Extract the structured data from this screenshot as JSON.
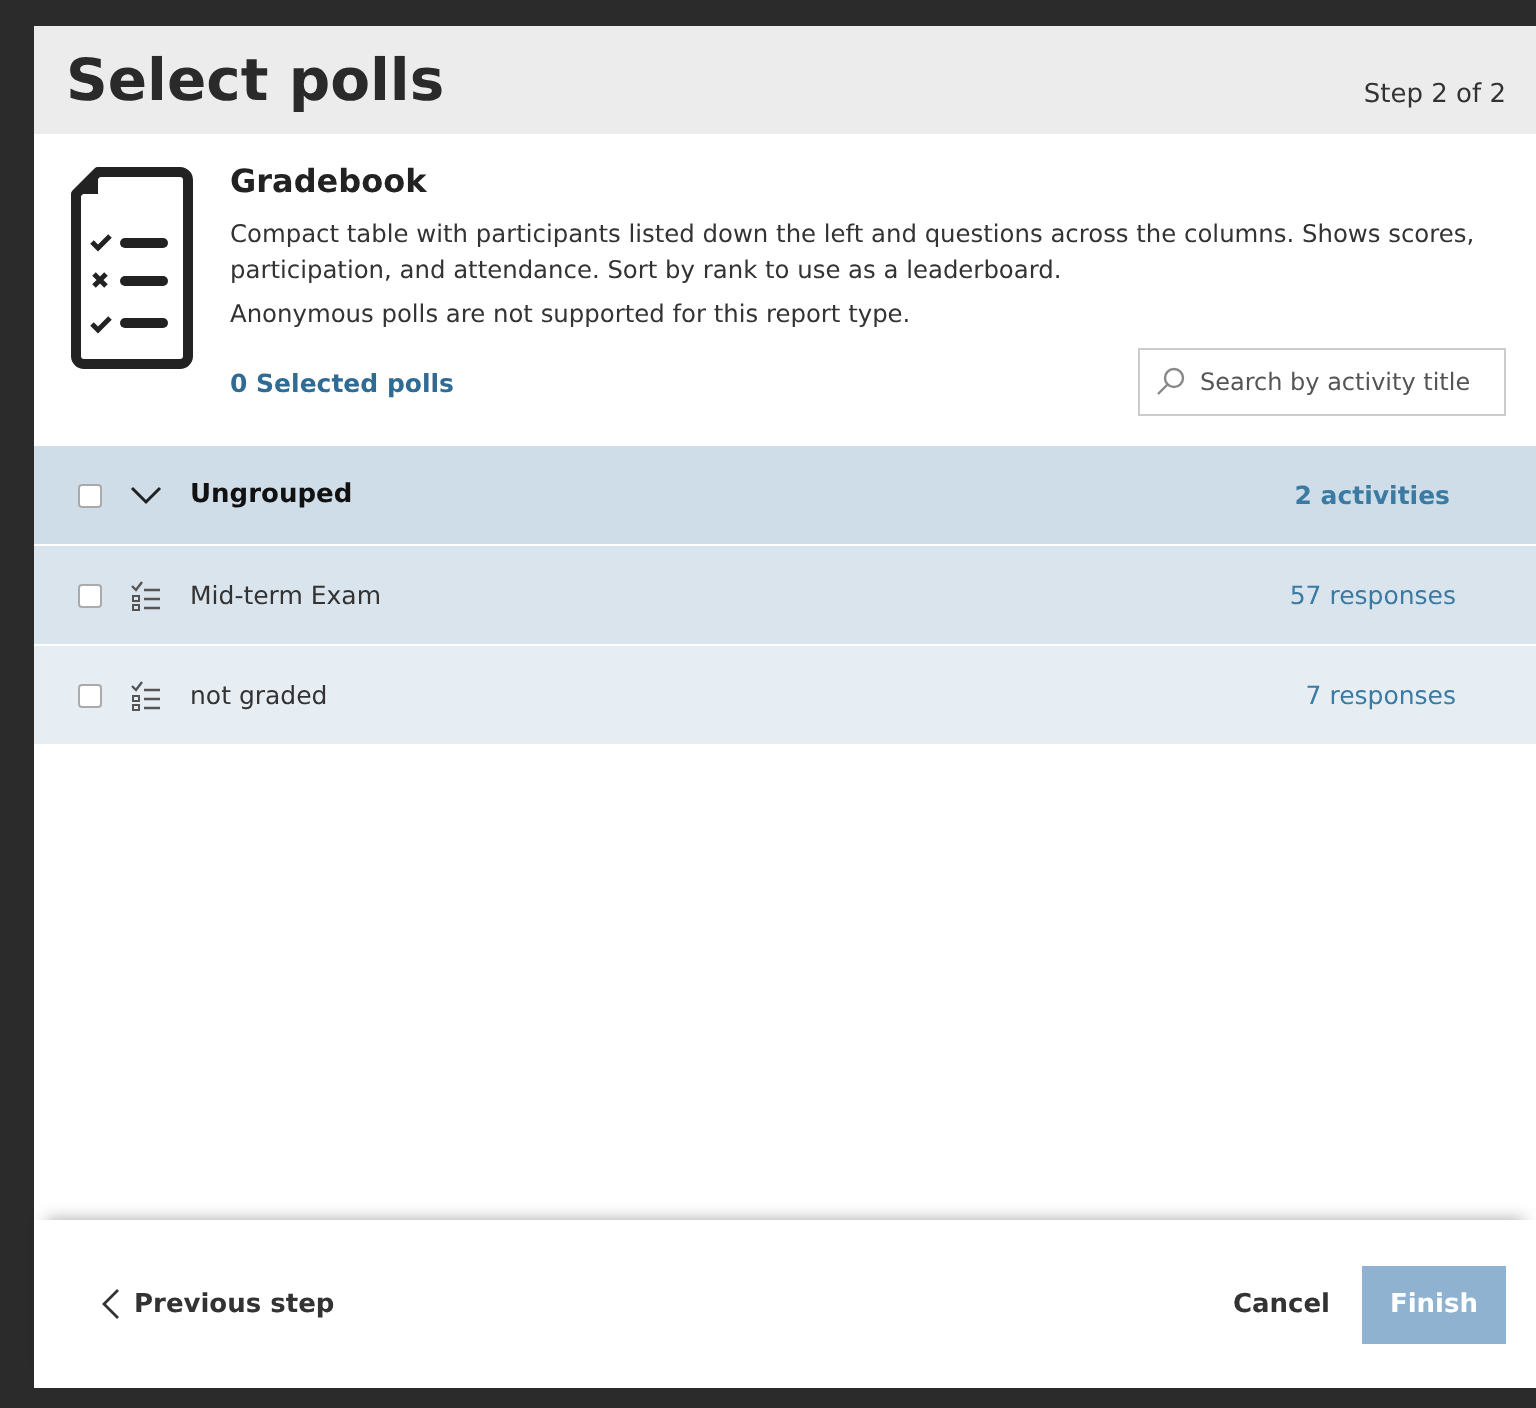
{
  "header": {
    "title": "Select polls",
    "step": "Step 2 of 2"
  },
  "report": {
    "title": "Gradebook",
    "description": "Compact table with participants listed down the left and questions across the columns. Shows scores, participation, and attendance. Sort by rank to use as a leaderboard.",
    "note": "Anonymous polls are not supported for this report type."
  },
  "selected_count": "0 Selected polls",
  "search": {
    "placeholder": "Search by activity title"
  },
  "group": {
    "label": "Ungrouped",
    "count": "2 activities",
    "checked": false,
    "expanded": true,
    "items": [
      {
        "title": "Mid-term Exam",
        "responses": "57 responses",
        "checked": false
      },
      {
        "title": "not graded",
        "responses": "7 responses",
        "checked": false
      }
    ]
  },
  "footer": {
    "back": "Previous step",
    "cancel": "Cancel",
    "finish": {
      "label": "Finish",
      "disabled": true
    }
  }
}
